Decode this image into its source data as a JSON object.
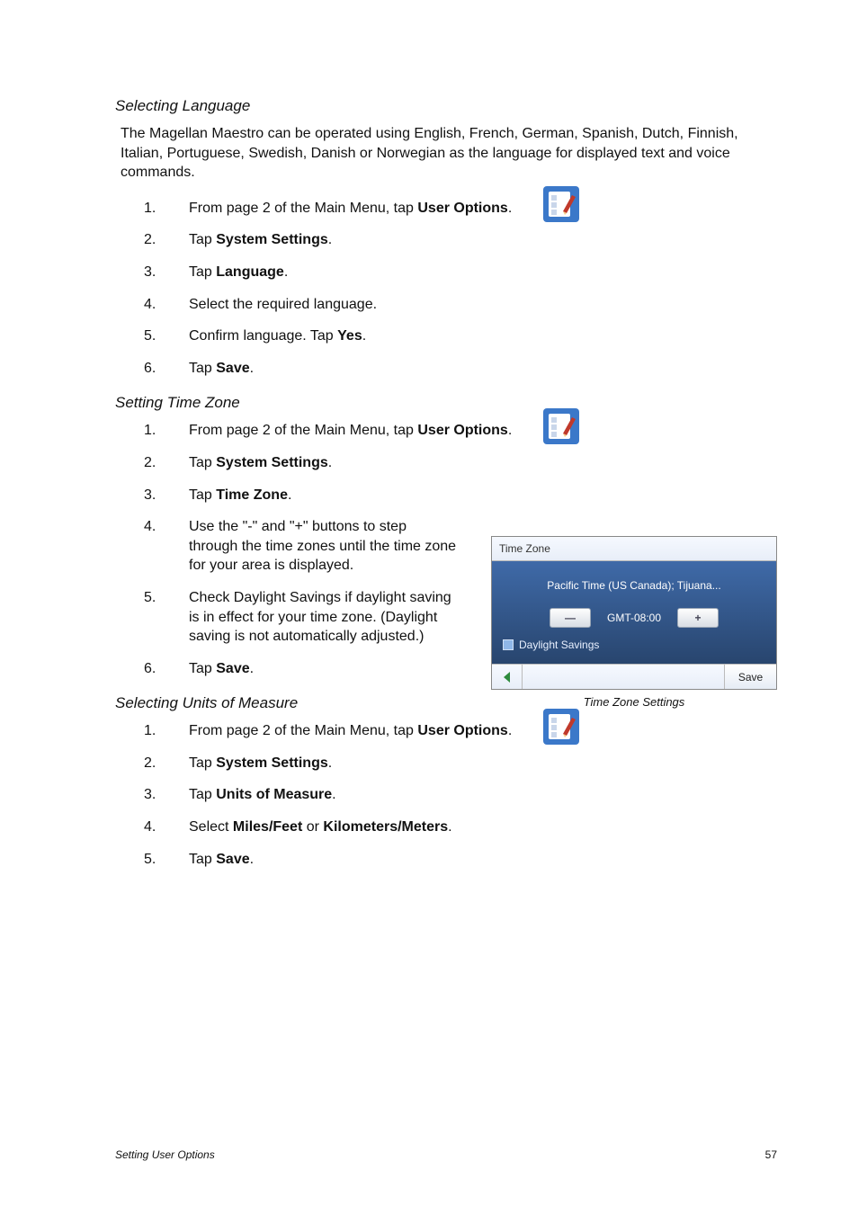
{
  "sections": {
    "lang": {
      "title": "Selecting Language",
      "intro": "The Magellan Maestro can be operated using English, French, German, Spanish, Dutch,  Finnish, Italian, Portuguese, Swedish, Danish or Norwegian as the language for displayed text and voice commands.",
      "steps": {
        "s1_pre": "From page 2 of the Main Menu, tap ",
        "s1_b": "User Options",
        "s1_post": ".",
        "s2_pre": "Tap ",
        "s2_b": "System Settings",
        "s2_post": ".",
        "s3_pre": "Tap ",
        "s3_b": "Language",
        "s3_post": ".",
        "s4": "Select the required language.",
        "s5_pre": "Confirm language.  Tap ",
        "s5_b": "Yes",
        "s5_post": ".",
        "s6_pre": "Tap ",
        "s6_b": "Save",
        "s6_post": "."
      }
    },
    "tz": {
      "title": "Setting Time Zone",
      "steps": {
        "s1_pre": "From page 2 of the Main Menu, tap ",
        "s1_b": "User Options",
        "s1_post": ".",
        "s2_pre": "Tap ",
        "s2_b": "System Settings",
        "s2_post": ".",
        "s3_pre": "Tap ",
        "s3_b": "Time Zone",
        "s3_post": ".",
        "s4": "Use the \"-\" and \"+\" buttons to step through the time zones until the time zone for your area is displayed.",
        "s5": "Check Daylight Savings if daylight saving is in effect for your time zone.  (Daylight saving is not automatically adjusted.)",
        "s6_pre": "Tap ",
        "s6_b": "Save",
        "s6_post": "."
      }
    },
    "units": {
      "title": "Selecting Units of Measure",
      "steps": {
        "s1_pre": "From page 2 of the Main Menu, tap ",
        "s1_b": "User Options",
        "s1_post": ".",
        "s2_pre": "Tap ",
        "s2_b": "System Settings",
        "s2_post": ".",
        "s3_pre": "Tap ",
        "s3_b": "Units of Measure",
        "s3_post": ".",
        "s4_pre": "Select ",
        "s4_b1": "Miles/Feet",
        "s4_mid": " or ",
        "s4_b2": "Kilometers/Meters",
        "s4_post": ".",
        "s5_pre": "Tap ",
        "s5_b": "Save",
        "s5_post": "."
      }
    }
  },
  "tz_screenshot": {
    "title": "Time Zone",
    "zone_name": "Pacific Time (US  Canada); Tijuana...",
    "minus": "—",
    "gmt": "GMT-08:00",
    "plus": "+",
    "daylight": "Daylight Savings",
    "save_btn": "Save",
    "caption": "Time Zone Settings"
  },
  "nums": {
    "n1": "1.",
    "n2": "2.",
    "n3": "3.",
    "n4": "4.",
    "n5": "5.",
    "n6": "6."
  },
  "footer": {
    "section": "Setting User Options",
    "page": "57"
  }
}
